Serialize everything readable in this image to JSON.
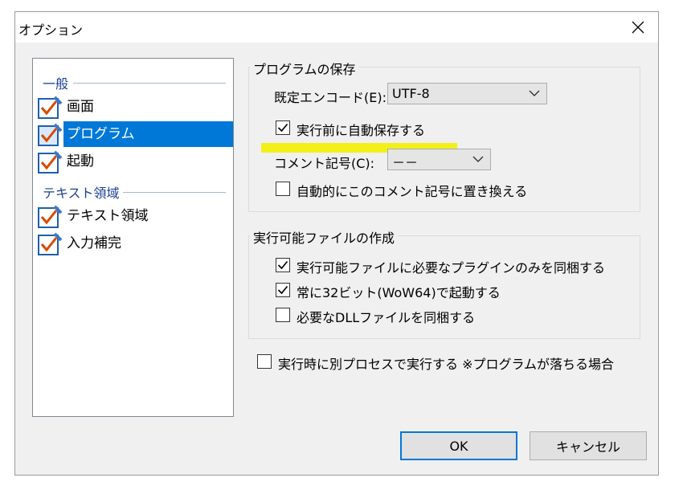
{
  "window": {
    "title": "オプション"
  },
  "tree": {
    "categories": [
      {
        "label": "一般",
        "items": [
          {
            "label": "画面",
            "selected": false
          },
          {
            "label": "プログラム",
            "selected": true
          },
          {
            "label": "起動",
            "selected": false
          }
        ]
      },
      {
        "label": "テキスト領域",
        "items": [
          {
            "label": "テキスト領域",
            "selected": false
          },
          {
            "label": "入力補完",
            "selected": false
          }
        ]
      }
    ]
  },
  "save_group": {
    "title": "プログラムの保存",
    "encode_label": "既定エンコード(E):",
    "encode_value": "UTF-8",
    "autosave_label": "実行前に自動保存する",
    "autosave_checked": true,
    "comment_label": "コメント記号(C):",
    "comment_value": "－－",
    "autoreplace_label": "自動的にこのコメント記号に置き換える",
    "autoreplace_checked": false
  },
  "exe_group": {
    "title": "実行可能ファイルの作成",
    "plugins_label": "実行可能ファイルに必要なプラグインのみを同梱する",
    "plugins_checked": true,
    "wow64_label": "常に32ビット(WoW64)で起動する",
    "wow64_checked": true,
    "dll_label": "必要なDLLファイルを同梱する",
    "dll_checked": false
  },
  "separate_process": {
    "label": "実行時に別プロセスで実行する ※プログラムが落ちる場合",
    "checked": false
  },
  "buttons": {
    "ok": "OK",
    "cancel": "キャンセル"
  },
  "colors": {
    "selection": "#0078d7",
    "highlight": "#f2ef00",
    "category_text": "#1c3f95"
  }
}
